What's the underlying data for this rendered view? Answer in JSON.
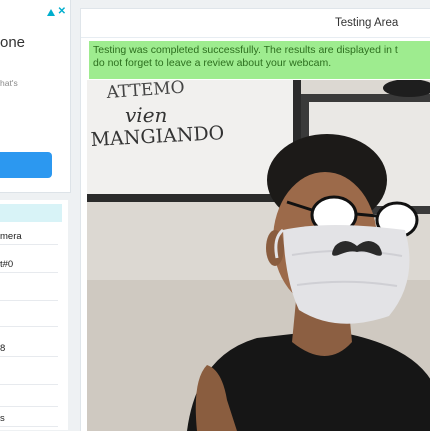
{
  "sidebar": {
    "ad": {
      "title_partial": "one",
      "text_partial": "hat's"
    },
    "info_rows": [
      "mera",
      "t#0",
      "8",
      "s"
    ]
  },
  "testing_area": {
    "title": "Testing Area",
    "alert_line1": "Testing was completed successfully. The results are displayed in t",
    "alert_line2": "do not forget to leave a review about your webcam."
  },
  "webcam_view": {
    "poster_text_line1": "ATTEMO",
    "poster_text_line2": "vien",
    "poster_text_line3": "MANGIANDO"
  },
  "colors": {
    "alert_bg": "#9eec8f",
    "alert_text": "#2d6f1f",
    "button_blue": "#2c98f0",
    "info_header": "#d8f3f7",
    "ad_choices": "#00aecd"
  }
}
